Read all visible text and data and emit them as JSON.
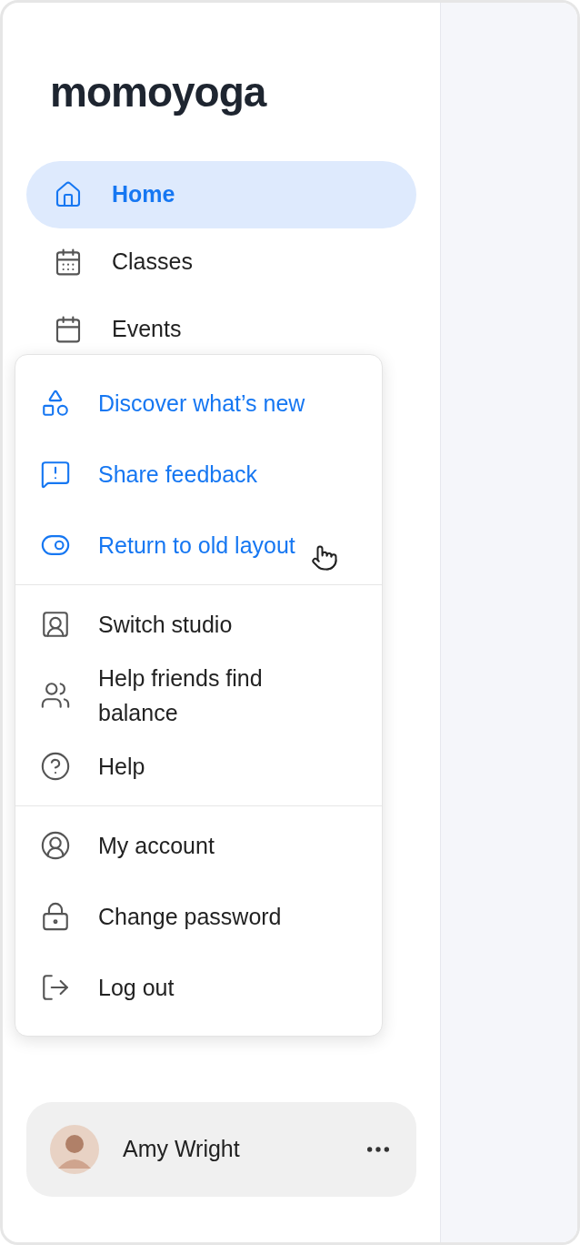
{
  "logo": "momoyoga",
  "nav": [
    {
      "label": "Home",
      "selected": true
    },
    {
      "label": "Classes",
      "selected": false
    },
    {
      "label": "Events",
      "selected": false
    }
  ],
  "menu": {
    "groups": [
      [
        {
          "label": "Discover what’s new",
          "kind": "feature"
        },
        {
          "label": "Share feedback",
          "kind": "feature"
        },
        {
          "label": "Return to old layout",
          "kind": "feature"
        }
      ],
      [
        {
          "label": "Switch studio",
          "kind": "default"
        },
        {
          "label": "Help friends find balance",
          "kind": "default"
        },
        {
          "label": "Help",
          "kind": "default"
        }
      ],
      [
        {
          "label": "My account",
          "kind": "default"
        },
        {
          "label": "Change password",
          "kind": "default"
        },
        {
          "label": "Log out",
          "kind": "default"
        }
      ]
    ]
  },
  "user": {
    "name": "Amy Wright"
  }
}
